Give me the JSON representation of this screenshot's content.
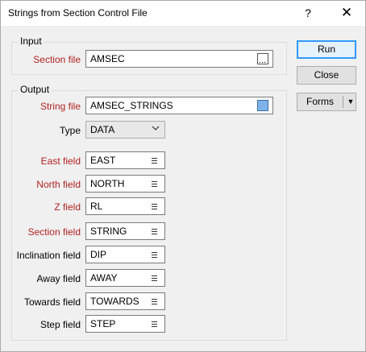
{
  "window": {
    "title": "Strings from Section Control File",
    "help_label": "?",
    "close_label": "✕"
  },
  "input_group": {
    "legend": "Input",
    "section_file": {
      "label": "Section file",
      "value": "AMSEC"
    }
  },
  "output_group": {
    "legend": "Output",
    "string_file": {
      "label": "String file",
      "value": "AMSEC_STRINGS"
    },
    "type": {
      "label": "Type",
      "value": "DATA"
    },
    "fields": [
      {
        "label": "East field",
        "value": "EAST",
        "required": true
      },
      {
        "label": "North field",
        "value": "NORTH",
        "required": true
      },
      {
        "label": "Z field",
        "value": "RL",
        "required": true
      },
      {
        "label": "Section field",
        "value": "STRING",
        "required": true
      },
      {
        "label": "Inclination field",
        "value": "DIP",
        "required": false
      },
      {
        "label": "Away field",
        "value": "AWAY",
        "required": false
      },
      {
        "label": "Towards field",
        "value": "TOWARDS",
        "required": false
      },
      {
        "label": "Step field",
        "value": "STEP",
        "required": false
      }
    ]
  },
  "buttons": {
    "run": "Run",
    "close": "Close",
    "forms": "Forms"
  },
  "colors": {
    "required_label": "#b22222",
    "default_button_border": "#3399ff"
  }
}
